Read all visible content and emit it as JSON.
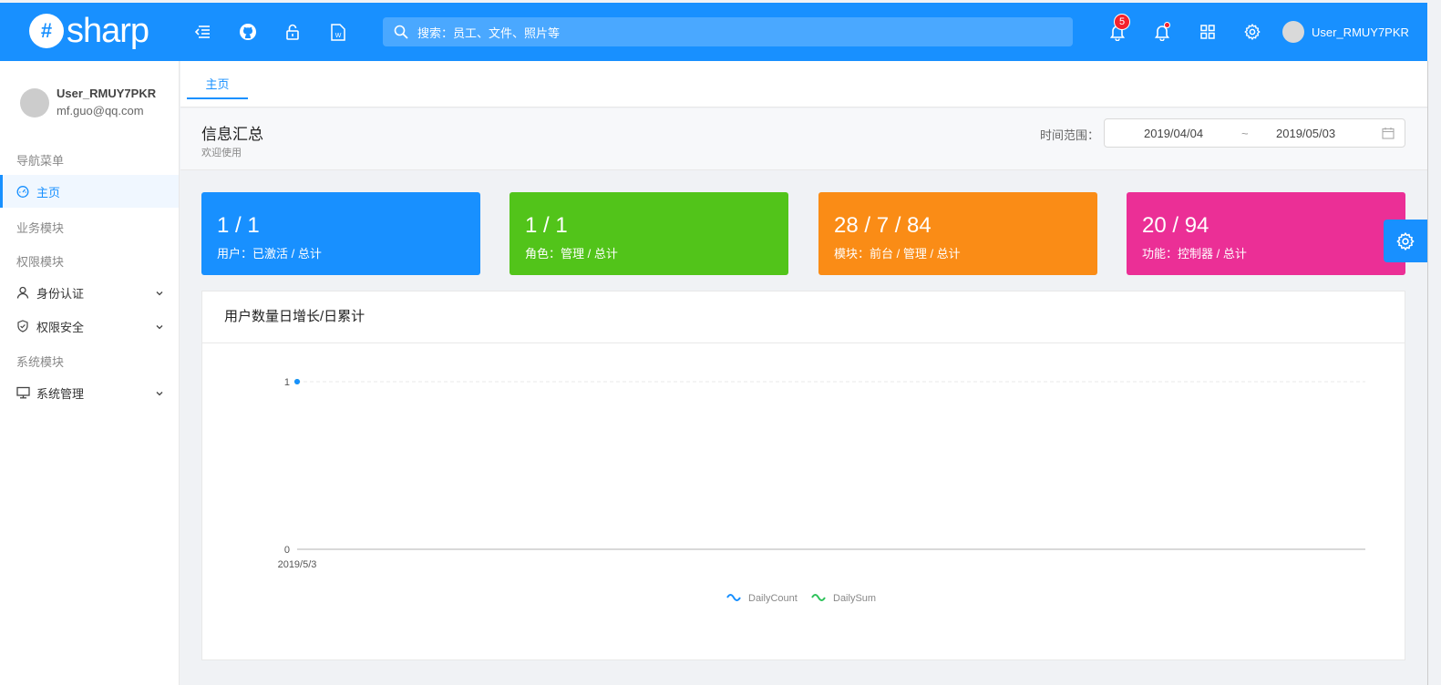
{
  "header": {
    "logo_text": "sharp",
    "logo_mark": "#",
    "search_placeholder": "搜索：员工、文件、照片等",
    "notification_count": "5",
    "username": "User_RMUY7PKR",
    "icons": [
      "menu-fold-icon",
      "github-icon",
      "lock-icon",
      "word-document-icon",
      "bell-icon",
      "bell-dot-icon",
      "apps-grid-icon",
      "gear-icon"
    ]
  },
  "sidebar": {
    "user": {
      "name": "User_RMUY7PKR",
      "email": "mf.guo@qq.com"
    },
    "groups": {
      "nav": "导航菜单",
      "business": "业务模块",
      "permission": "权限模块",
      "system": "系统模块"
    },
    "items": {
      "home": "主页",
      "identity": "身份认证",
      "security": "权限安全",
      "system_admin": "系统管理"
    }
  },
  "tabs": [
    "主页"
  ],
  "page": {
    "title": "信息汇总",
    "subtitle": "欢迎使用",
    "range_label": "时间范围：",
    "range_start": "2019/04/04",
    "range_sep": "~",
    "range_end": "2019/05/03"
  },
  "cards": [
    {
      "value": "1 / 1",
      "label": "用户：已激活 / 总计",
      "color": "#1890ff"
    },
    {
      "value": "1 / 1",
      "label": "角色：管理 / 总计",
      "color": "#52c41a"
    },
    {
      "value": "28 / 7 / 84",
      "label": "模块：前台 / 管理 / 总计",
      "color": "#fa8c16"
    },
    {
      "value": "20 / 94",
      "label": "功能：控制器 / 总计",
      "color": "#eb2f96"
    }
  ],
  "chart_panel": {
    "title": "用户数量日增长/日累计"
  },
  "chart_data": {
    "type": "line",
    "x": [
      "2019/5/3"
    ],
    "series": [
      {
        "name": "DailyCount",
        "values": [
          1
        ],
        "color": "#1890ff"
      },
      {
        "name": "DailySum",
        "values": [
          1
        ],
        "color": "#2fc25b"
      }
    ],
    "yticks": [
      "0",
      "1"
    ],
    "ylim": [
      0,
      1
    ],
    "legend": "bottom-center",
    "grid": true
  }
}
